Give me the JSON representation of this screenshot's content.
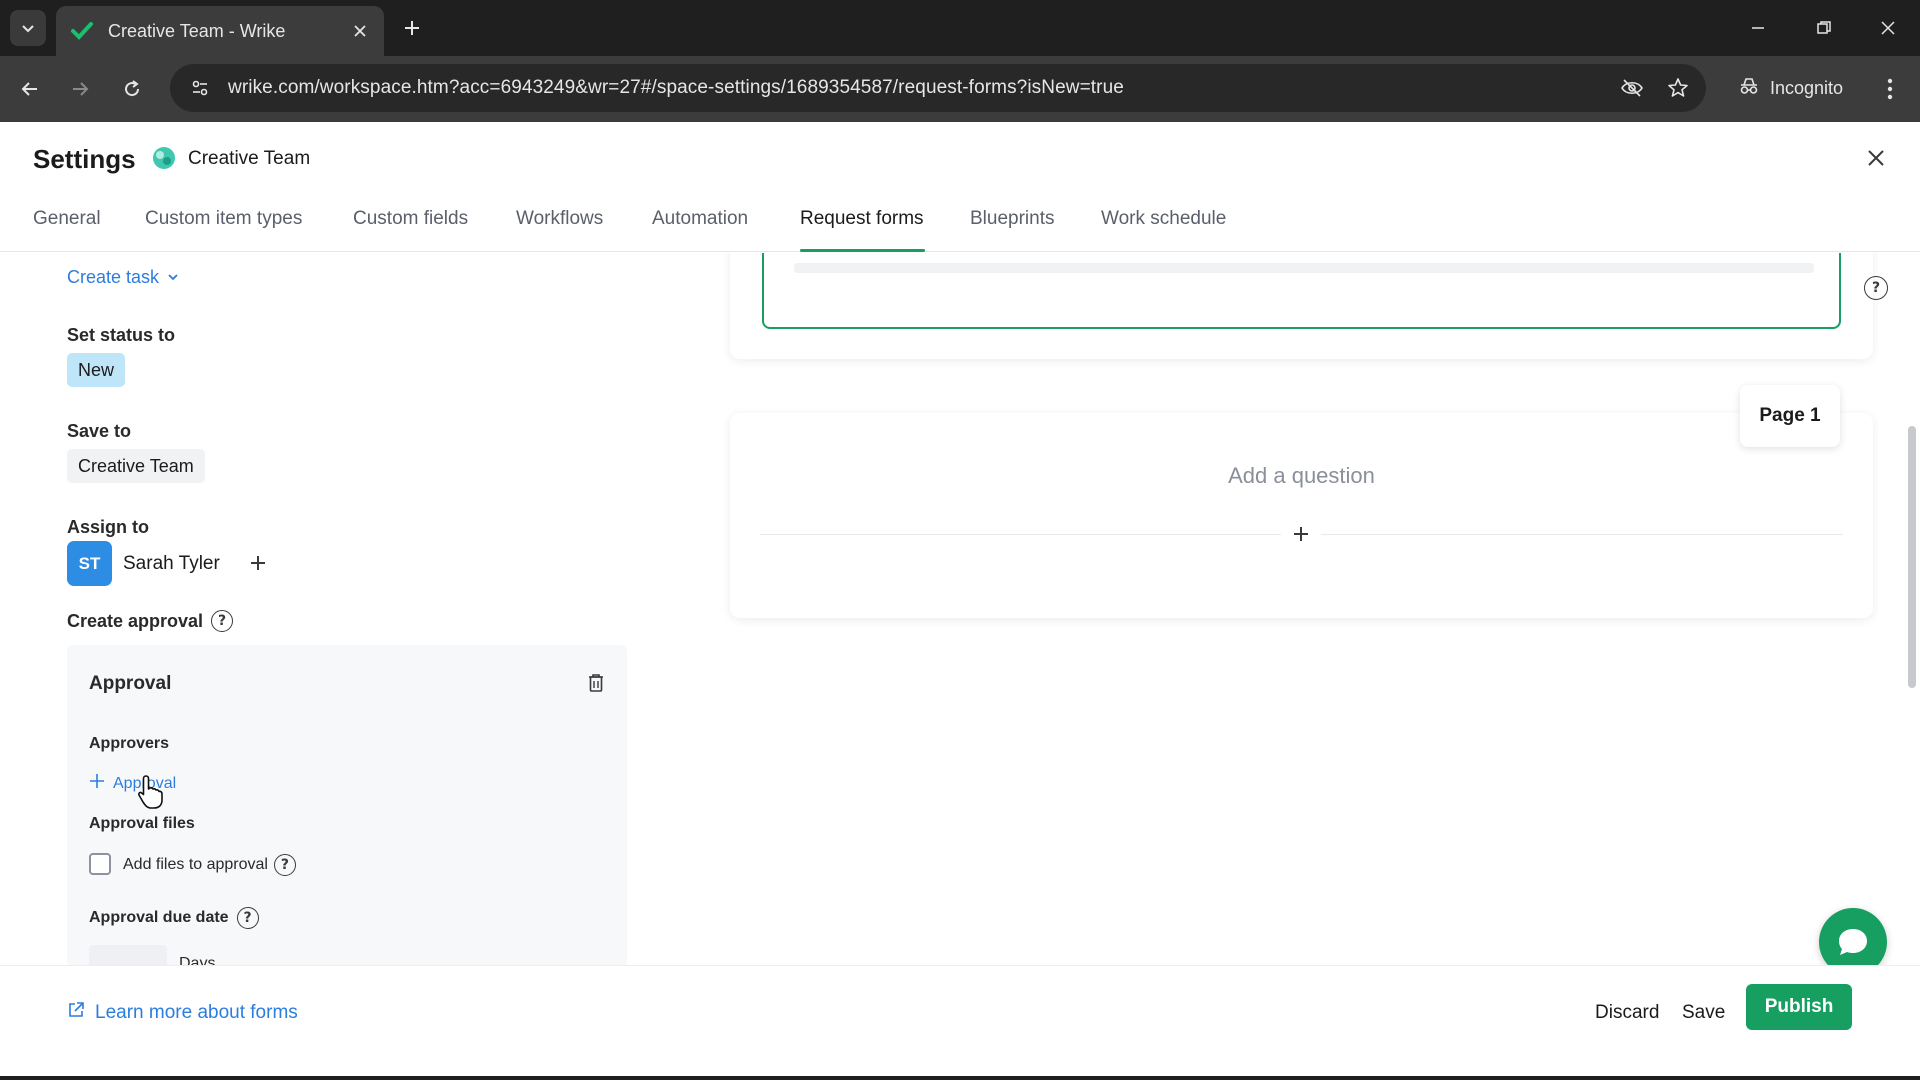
{
  "browser": {
    "tab_title": "Creative Team - Wrike",
    "url": "wrike.com/workspace.htm?acc=6943249&wr=27#/space-settings/1689354587/request-forms?isNew=true",
    "incognito_label": "Incognito"
  },
  "header": {
    "title": "Settings",
    "space_name": "Creative Team"
  },
  "tabs": [
    {
      "label": "General"
    },
    {
      "label": "Custom item types"
    },
    {
      "label": "Custom fields"
    },
    {
      "label": "Workflows"
    },
    {
      "label": "Automation"
    },
    {
      "label": "Request forms",
      "active": true
    },
    {
      "label": "Blueprints"
    },
    {
      "label": "Work schedule"
    }
  ],
  "left": {
    "create_task": "Create task",
    "set_status_label": "Set status to",
    "status_value": "New",
    "save_to_label": "Save to",
    "save_to_value": "Creative Team",
    "assign_to_label": "Assign to",
    "assignee_initials": "ST",
    "assignee_name": "Sarah Tyler",
    "create_approval_label": "Create approval",
    "approval": {
      "title": "Approval",
      "approvers_label": "Approvers",
      "add_approver": "Approval",
      "files_label": "Approval files",
      "add_files_label": "Add files to approval",
      "add_files_checked": false,
      "due_date_label": "Approval due date",
      "days_label": "Days"
    }
  },
  "preview": {
    "page_label": "Page 1",
    "add_question": "Add a question"
  },
  "footer": {
    "learn_more": "Learn more about forms",
    "discard": "Discard",
    "save": "Save",
    "publish": "Publish"
  },
  "colors": {
    "accent": "#169f61",
    "link": "#2b7dde",
    "status_chip": "#bfe6f8",
    "avatar": "#2d8ce3"
  },
  "icons": {
    "help": "?"
  }
}
